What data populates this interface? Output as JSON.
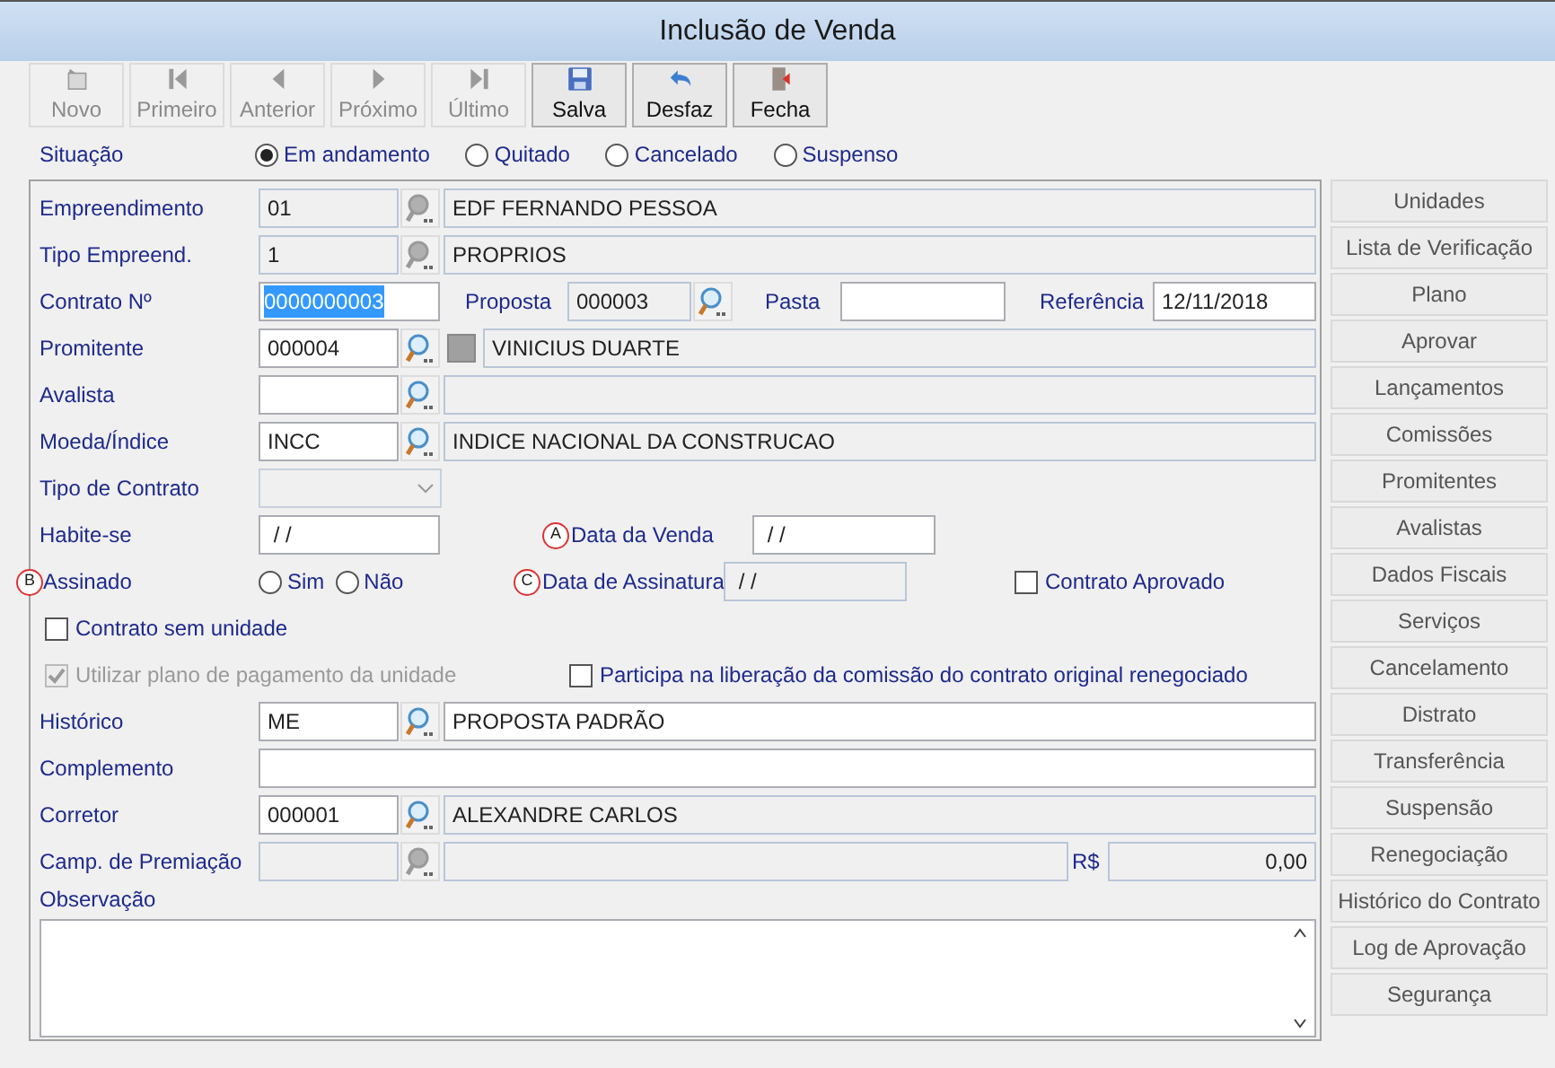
{
  "window": {
    "title": "Inclusão de Venda"
  },
  "toolbar": [
    {
      "label": "Novo",
      "disabled": true
    },
    {
      "label": "Primeiro",
      "disabled": true
    },
    {
      "label": "Anterior",
      "disabled": true
    },
    {
      "label": "Próximo",
      "disabled": true
    },
    {
      "label": "Último",
      "disabled": true
    },
    {
      "label": "Salva",
      "disabled": false
    },
    {
      "label": "Desfaz",
      "disabled": false
    },
    {
      "label": "Fecha",
      "disabled": false
    }
  ],
  "situacao": {
    "label": "Situação",
    "options": [
      {
        "label": "Em andamento",
        "selected": true
      },
      {
        "label": "Quitado",
        "selected": false
      },
      {
        "label": "Cancelado",
        "selected": false
      },
      {
        "label": "Suspenso",
        "selected": false
      }
    ]
  },
  "form": {
    "empreendimento": {
      "label": "Empreendimento",
      "code": "01",
      "code_disabled": true,
      "lookup_disabled": true,
      "description": "EDF FERNANDO PESSOA",
      "description_readonly": true
    },
    "tipo_empreend": {
      "label": "Tipo Empreend.",
      "code": "1",
      "code_disabled": true,
      "lookup_disabled": true,
      "description": "PROPRIOS",
      "description_readonly": true
    },
    "contrato": {
      "label": "Contrato Nº",
      "value": "0000000003",
      "selected": true
    },
    "proposta": {
      "label": "Proposta",
      "value": "000003"
    },
    "pasta": {
      "label": "Pasta"
    },
    "referencia": {
      "label": "Referência",
      "value": "12/11/2018"
    },
    "promitente": {
      "label": "Promitente",
      "code": "000004",
      "code_disabled": false,
      "lookup_disabled": false,
      "swatch": true,
      "description": "VINICIUS DUARTE",
      "description_readonly": true
    },
    "avalista": {
      "label": "Avalista",
      "code_disabled": false,
      "lookup_disabled": false,
      "description_readonly": true
    },
    "moeda": {
      "label": "Moeda/Índice",
      "code": "INCC",
      "code_disabled": false,
      "lookup_disabled": false,
      "description": "INDICE NACIONAL DA CONSTRUCAO",
      "description_readonly": true
    },
    "tipo_contrato": {
      "label": "Tipo de Contrato",
      "disabled": true
    },
    "habite_se": {
      "label": "Habite-se",
      "value": " / /"
    },
    "data_venda": {
      "marker": "A",
      "label": "Data da Venda",
      "value": " / /",
      "disabled": false
    },
    "assinado": {
      "marker": "B",
      "label": "Assinado",
      "options": [
        {
          "label": "Sim",
          "selected": false
        },
        {
          "label": "Não",
          "selected": false
        }
      ]
    },
    "data_assinatura": {
      "marker": "C",
      "label": "Data de Assinatura",
      "value": " / /",
      "disabled": true
    },
    "contrato_aprovado": {
      "label": "Contrato Aprovado",
      "checked": false,
      "disabled": false
    },
    "contrato_sem_unidade": {
      "label": "Contrato sem unidade",
      "checked": false,
      "disabled": false
    },
    "utilizar_plano": {
      "label": "Utilizar plano de pagamento da unidade",
      "checked": true,
      "disabled": true
    },
    "participa": {
      "label": "Participa na liberação da comissão do contrato original renegociado",
      "checked": false,
      "disabled": false
    },
    "historico": {
      "label": "Histórico",
      "code": "ME",
      "code_disabled": false,
      "lookup_disabled": false,
      "description": "PROPOSTA PADRÃO",
      "description_readonly": false
    },
    "complemento": {
      "label": "Complemento"
    },
    "corretor": {
      "label": "Corretor",
      "code": "000001",
      "code_disabled": false,
      "lookup_disabled": false,
      "description": "ALEXANDRE CARLOS",
      "description_readonly": true
    },
    "camp_premiacao": {
      "label": "Camp. de Premiação",
      "code_disabled": true,
      "lookup_disabled": true,
      "description_readonly": true,
      "currency": "R$",
      "amount": "0,00"
    },
    "observacao": {
      "label": "Observação"
    }
  },
  "side_buttons": [
    {
      "label": "Unidades"
    },
    {
      "label": "Lista de Verificação"
    },
    {
      "label": "Plano"
    },
    {
      "label": "Aprovar"
    },
    {
      "label": "Lançamentos"
    },
    {
      "label": "Comissões"
    },
    {
      "label": "Promitentes"
    },
    {
      "label": "Avalistas"
    },
    {
      "label": "Dados Fiscais"
    },
    {
      "label": "Serviços"
    },
    {
      "label": "Cancelamento"
    },
    {
      "label": "Distrato"
    },
    {
      "label": "Transferência"
    },
    {
      "label": "Suspensão"
    },
    {
      "label": "Renegociação"
    },
    {
      "label": "Histórico do Contrato"
    },
    {
      "label": "Log de Aprovação"
    },
    {
      "label": "Segurança"
    }
  ]
}
